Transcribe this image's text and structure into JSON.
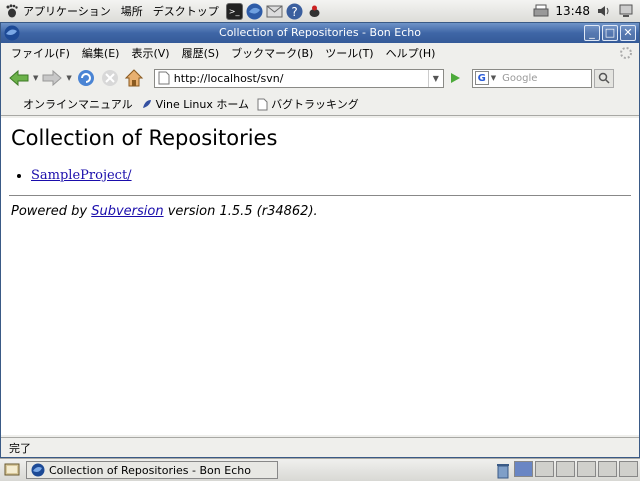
{
  "top_panel": {
    "menus": [
      "アプリケーション",
      "場所",
      "デスクトップ"
    ],
    "clock": "13:48"
  },
  "window": {
    "title": "Collection of Repositories - Bon Echo"
  },
  "menubar": {
    "items": [
      "ファイル(F)",
      "編集(E)",
      "表示(V)",
      "履歴(S)",
      "ブックマーク(B)",
      "ツール(T)",
      "ヘルプ(H)"
    ]
  },
  "navbar": {
    "url": "http://localhost/svn/",
    "search_placeholder": "Google"
  },
  "bookmarks": {
    "items": [
      "オンラインマニュアル",
      "Vine Linux ホーム",
      "バグトラッキング"
    ]
  },
  "page": {
    "heading": "Collection of Repositories",
    "repo_link": "SampleProject/",
    "powered_prefix": "Powered by ",
    "powered_link": "Subversion",
    "powered_suffix": " version 1.5.5 (r34862)."
  },
  "status": {
    "text": "完了"
  },
  "taskbar": {
    "task_title": "Collection of Repositories - Bon Echo"
  },
  "colors": {
    "titlebar": "#3f66a6",
    "link": "#1a0dab"
  }
}
